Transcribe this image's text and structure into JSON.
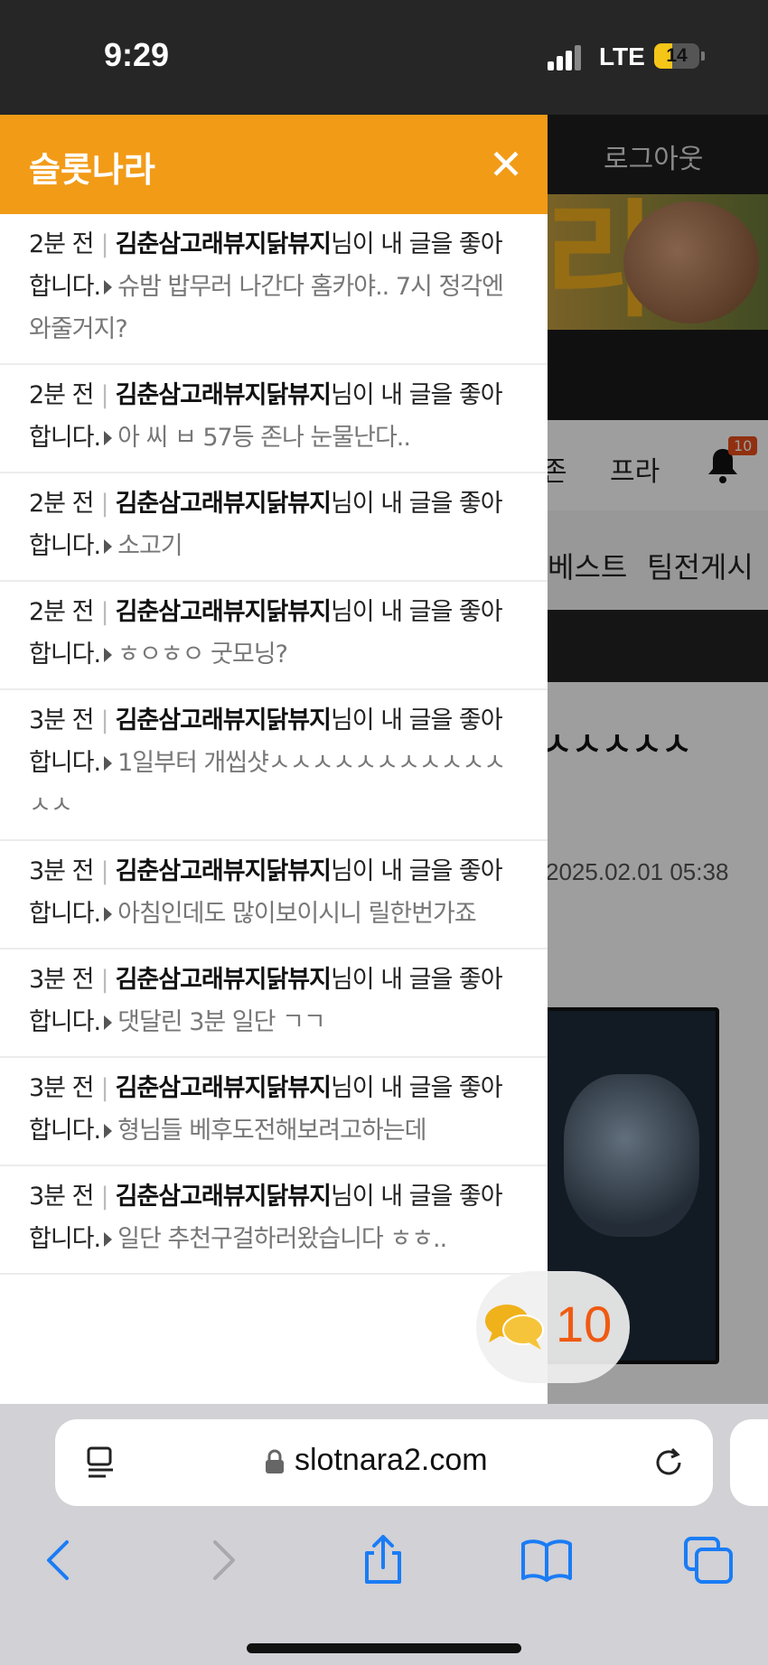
{
  "status_bar": {
    "time": "9:29",
    "network": "LTE",
    "battery": "14"
  },
  "background_page": {
    "logout": "로그아웃",
    "banner_char": "라",
    "nav": [
      "존",
      "프라"
    ],
    "bell_badge": "10",
    "subnav": [
      "베스트",
      "팀전게시"
    ],
    "title_fragment": "ㅅㅅㅅㅅㅅ",
    "post_date": "2025.02.01 05:38"
  },
  "panel": {
    "title": "슬롯나라",
    "notifications": [
      {
        "time": "2분 전",
        "user": "김춘삼고래뷰지닭뷰지",
        "action": "님이 내 글을 좋아합니다.",
        "post": "슈밤 밥무러 나간다 홈카야.. 7시 정각엔 와줄거지?"
      },
      {
        "time": "2분 전",
        "user": "김춘삼고래뷰지닭뷰지",
        "action": "님이 내 글을 좋아합니다.",
        "post": "아 씨 ㅂ 57등 존나 눈물난다.."
      },
      {
        "time": "2분 전",
        "user": "김춘삼고래뷰지닭뷰지",
        "action": "님이 내 글을 좋아합니다.",
        "post": "소고기"
      },
      {
        "time": "2분 전",
        "user": "김춘삼고래뷰지닭뷰지",
        "action": "님이 내 글을 좋아합니다.",
        "post": "ㅎㅇㅎㅇ 굿모닝?"
      },
      {
        "time": "3분 전",
        "user": "김춘삼고래뷰지닭뷰지",
        "action": "님이 내 글을 좋아합니다.",
        "post": "1일부터 개씹샷ㅅㅅㅅㅅㅅㅅㅅㅅㅅㅅㅅㅅㅅ"
      },
      {
        "time": "3분 전",
        "user": "김춘삼고래뷰지닭뷰지",
        "action": "님이 내 글을 좋아합니다.",
        "post": "아침인데도 많이보이시니 릴한번가죠"
      },
      {
        "time": "3분 전",
        "user": "김춘삼고래뷰지닭뷰지",
        "action": "님이 내 글을 좋아합니다.",
        "post": "댓달린 3분 일단 ㄱㄱ"
      },
      {
        "time": "3분 전",
        "user": "김춘삼고래뷰지닭뷰지",
        "action": "님이 내 글을 좋아합니다.",
        "post": "형님들 베후도전해보려고하는데"
      },
      {
        "time": "3분 전",
        "user": "김춘삼고래뷰지닭뷰지",
        "action": "님이 내 글을 좋아합니다.",
        "post": "일단 추천구걸하러왔습니다 ㅎㅎ.."
      }
    ]
  },
  "chat_fab": {
    "count": "10"
  },
  "browser": {
    "url": "slotnara2.com"
  },
  "colors": {
    "accent": "#f29b17",
    "chat_count": "#ef5a12"
  }
}
